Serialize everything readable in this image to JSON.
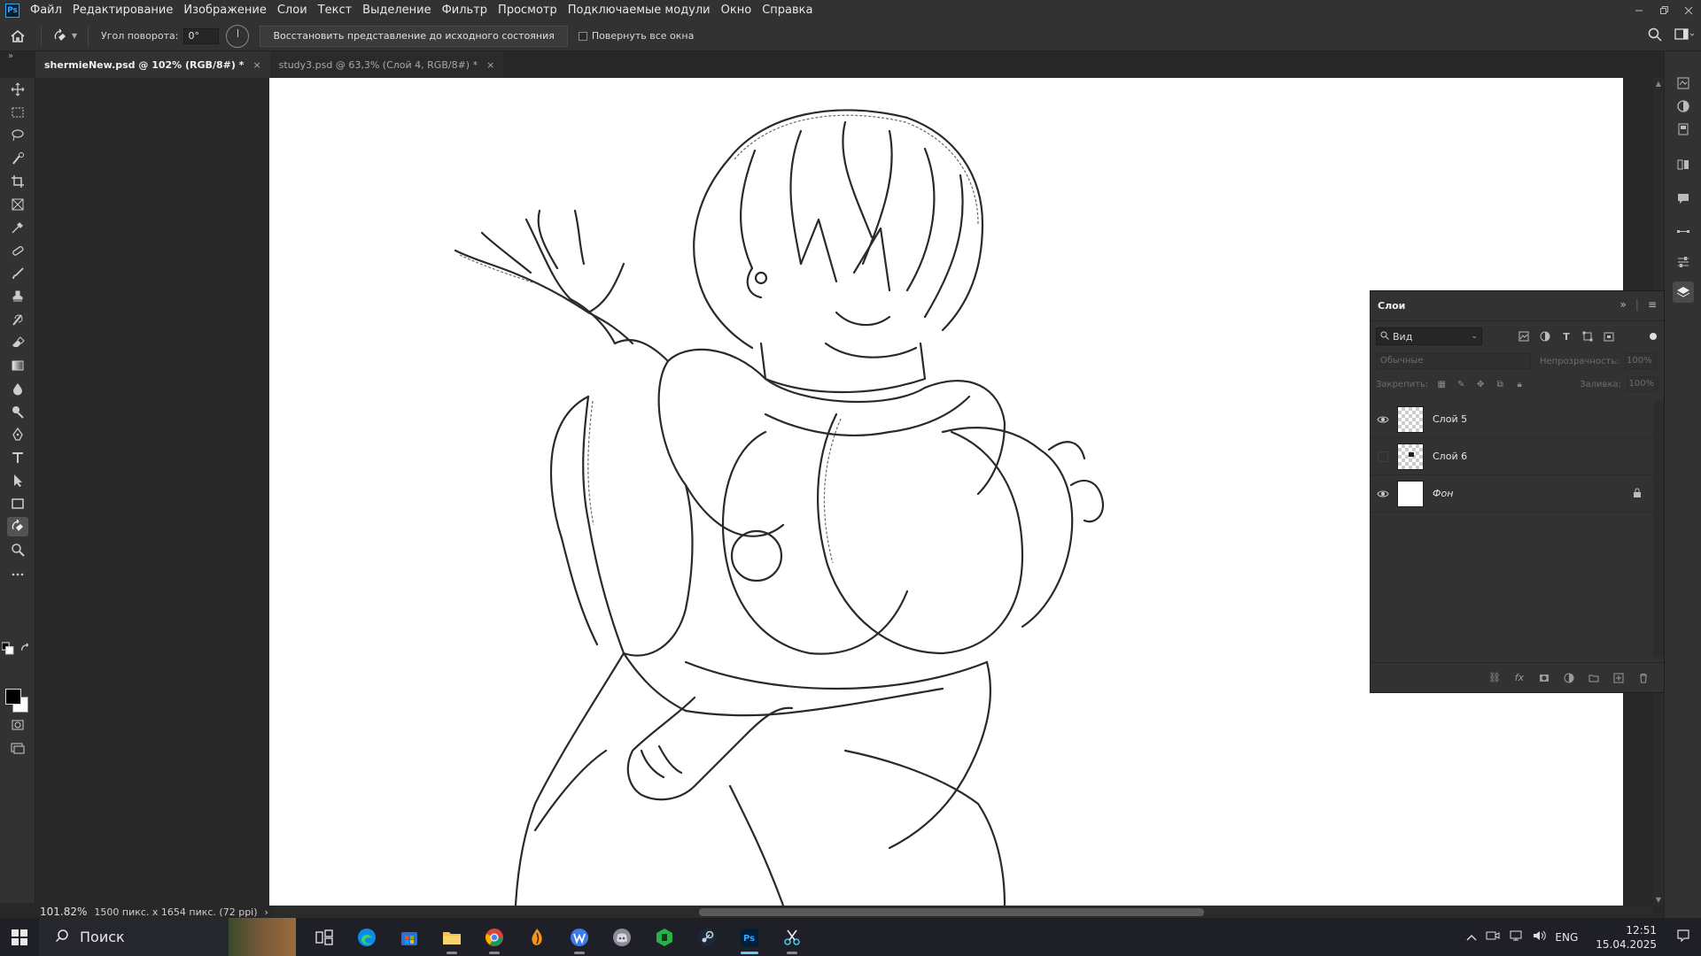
{
  "app": {
    "logo": "Ps",
    "menu": [
      "Файл",
      "Редактирование",
      "Изображение",
      "Слои",
      "Текст",
      "Выделение",
      "Фильтр",
      "Просмотр",
      "Подключаемые модули",
      "Окно",
      "Справка"
    ]
  },
  "options": {
    "rotation_label": "Угол поворота:",
    "rotation_value": "0°",
    "reset_view_button": "Восстановить представление до исходного состояния",
    "rotate_all_label": "Повернуть все окна",
    "rotate_all_checked": false
  },
  "tabs": [
    {
      "title": "shermieNew.psd @ 102% (RGB/8#) *",
      "active": true,
      "close": "×"
    },
    {
      "title": "study3.psd @ 63,3% (Слой 4, RGB/8#) *",
      "active": false,
      "close": "×"
    }
  ],
  "status": {
    "zoom": "101.82%",
    "doc_info": "1500 пикс. x 1654 пикс. (72 ppi)",
    "arrow": "›"
  },
  "layers_panel": {
    "title": "Слои",
    "filter_kind": "Вид",
    "blend_mode": "Обычные",
    "opacity_label": "Непрозрачность:",
    "opacity_value": "100%",
    "lock_label": "Закрепить:",
    "fill_label": "Заливка:",
    "fill_value": "100%",
    "layers": [
      {
        "name": "Слой 5",
        "visible": true,
        "thumb": "transparent",
        "locked": false
      },
      {
        "name": "Слой 6",
        "visible": false,
        "thumb": "transparent-mark",
        "locked": false
      },
      {
        "name": "Фон",
        "visible": true,
        "thumb": "white",
        "locked": true
      }
    ]
  },
  "taskbar": {
    "search_placeholder": "Поиск",
    "apps": [
      "task-view-icon",
      "edge-icon",
      "store-icon",
      "explorer-icon",
      "chrome-icon",
      "fl-studio-icon",
      "wps-icon",
      "discord-icon",
      "app-green-icon",
      "steam-icon",
      "photoshop-icon",
      "snipping-tool-icon"
    ],
    "language": "ENG",
    "time": "12:51",
    "date": "15.04.2025"
  },
  "colors": {
    "ui_bg": "#323232",
    "canvas_bg": "#282828",
    "accent_ps": "#31a8ff",
    "taskbar_accent": "#60cdff"
  }
}
